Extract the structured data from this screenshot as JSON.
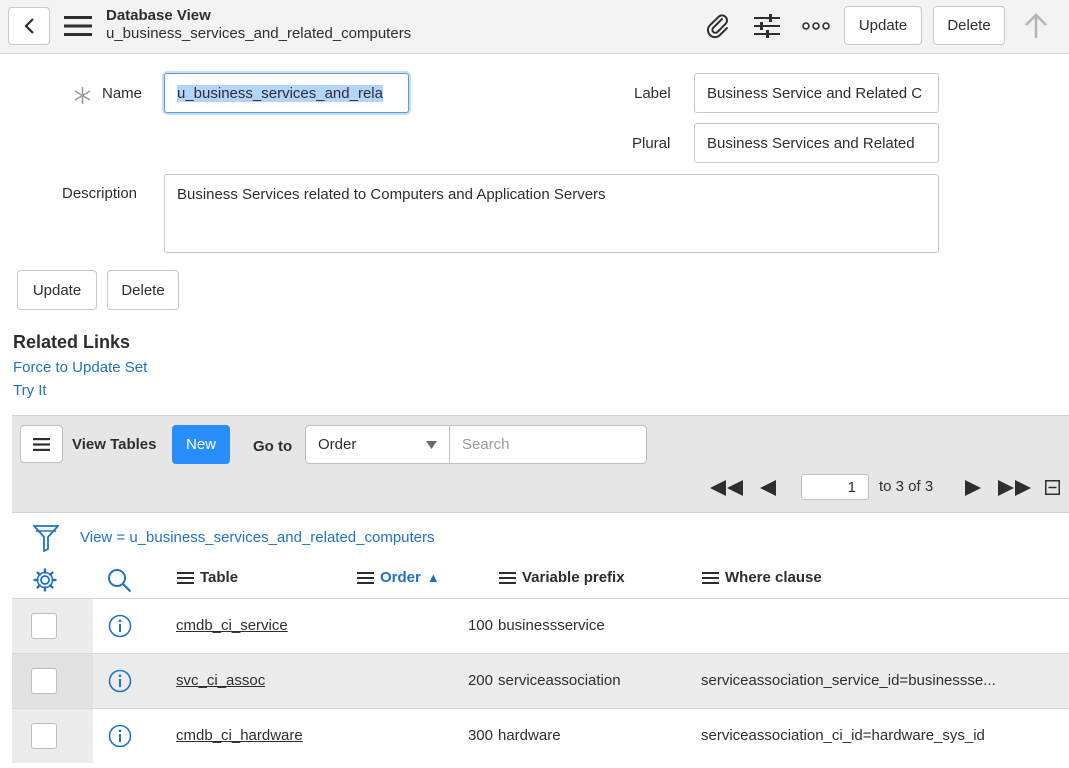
{
  "header": {
    "title": "Database View",
    "subtitle": "u_business_services_and_related_computers",
    "update_label": "Update",
    "delete_label": "Delete"
  },
  "form": {
    "name_label": "Name",
    "name_value": "u_business_services_and_rela",
    "label_label": "Label",
    "label_value": "Business Service and Related C",
    "plural_label": "Plural",
    "plural_value": "Business Services and Related",
    "description_label": "Description",
    "description_value": "Business Services related to Computers and Application Servers",
    "update_label": "Update",
    "delete_label": "Delete"
  },
  "related_links": {
    "title": "Related Links",
    "items": [
      "Force to Update Set",
      "Try It"
    ]
  },
  "list": {
    "title": "View Tables",
    "new_label": "New",
    "goto_label": "Go to",
    "goto_selected": "Order",
    "search_placeholder": "Search",
    "page_number": "1",
    "page_of": "to 3 of 3",
    "breadcrumb": "View = u_business_services_and_related_computers",
    "columns": [
      "Table",
      "Order",
      "Variable prefix",
      "Where clause"
    ],
    "sort_indicator": "▲",
    "rows": [
      {
        "table": "cmdb_ci_service",
        "order": "100",
        "prefix": "businessservice",
        "where": ""
      },
      {
        "table": "svc_ci_assoc",
        "order": "200",
        "prefix": "serviceassociation",
        "where": "serviceassociation_service_id=businessse..."
      },
      {
        "table": "cmdb_ci_hardware",
        "order": "300",
        "prefix": "hardware",
        "where": "serviceassociation_ci_id=hardware_sys_id"
      }
    ]
  },
  "colors": {
    "accent": "#278efc",
    "link": "#1f73c4"
  }
}
